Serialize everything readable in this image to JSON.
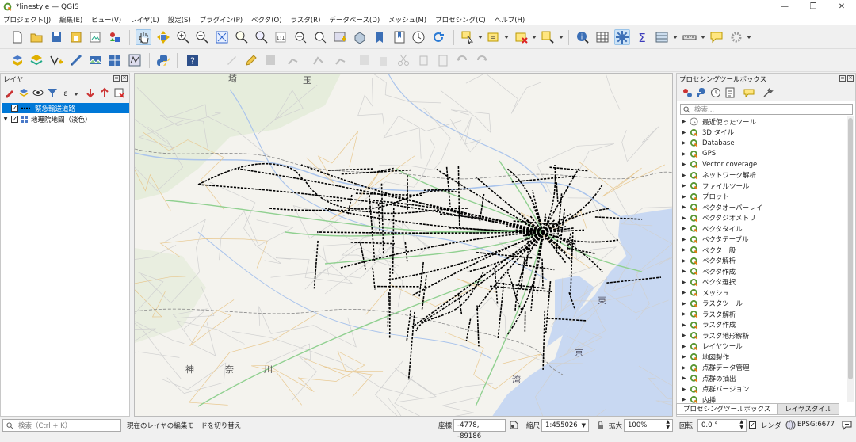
{
  "window": {
    "title": "*linestyle — QGIS",
    "controls": [
      "—",
      "❐",
      "✕"
    ]
  },
  "menu": [
    "プロジェクト(J)",
    "編集(E)",
    "ビュー(V)",
    "レイヤ(L)",
    "設定(S)",
    "プラグイン(P)",
    "ベクタ(O)",
    "ラスタ(R)",
    "データベース(D)",
    "メッシュ(M)",
    "プロセシング(C)",
    "ヘルプ(H)"
  ],
  "layers_panel": {
    "title": "レイヤ",
    "layers": [
      {
        "name": "緊急輸送道路",
        "checked": true,
        "selected": true
      },
      {
        "name": "地理院地図（淡色）",
        "checked": true,
        "selected": false
      }
    ]
  },
  "map": {
    "labels": [
      "埼",
      "玉",
      "東",
      "京",
      "神",
      "奈",
      "川",
      "湾"
    ],
    "colors": {
      "land": "#f4f3ee",
      "water": "#c8d8f2",
      "forest": "#e6eddc",
      "roads": "#000000",
      "rail": "#90d090"
    }
  },
  "processing": {
    "title": "プロセシングツールボックス",
    "search_placeholder": "検索...",
    "items": [
      "最近使ったツール",
      "3D タイル",
      "Database",
      "GPS",
      "Vector coverage",
      "ネットワーク解析",
      "ファイルツール",
      "プロット",
      "ベクタオーバーレイ",
      "ベクタジオメトリ",
      "ベクタタイル",
      "ベクタテーブル",
      "ベクター般",
      "ベクタ解析",
      "ベクタ作成",
      "ベクタ選択",
      "メッシュ",
      "ラスタツール",
      "ラスタ解析",
      "ラスタ作成",
      "ラスタ地形解析",
      "レイヤツール",
      "地図製作",
      "点群データ管理",
      "点群の抽出",
      "点群バージョン",
      "内挿"
    ],
    "tabs": [
      "プロセシングツールボックス",
      "レイヤスタイル"
    ]
  },
  "status": {
    "search_placeholder": "検索（Ctrl + K）",
    "message": "現在のレイヤの編集モードを切り替え",
    "coord_label": "座標",
    "coord_value": "-4778, -89186",
    "scale_label": "縮尺",
    "scale_value": "1:455026",
    "magnifier_label": "拡大",
    "magnifier_value": "100%",
    "rotation_label": "回転",
    "rotation_value": "0.0 °",
    "render_label": "レンダ",
    "render_checked": true,
    "crs": "EPSG:6677"
  }
}
